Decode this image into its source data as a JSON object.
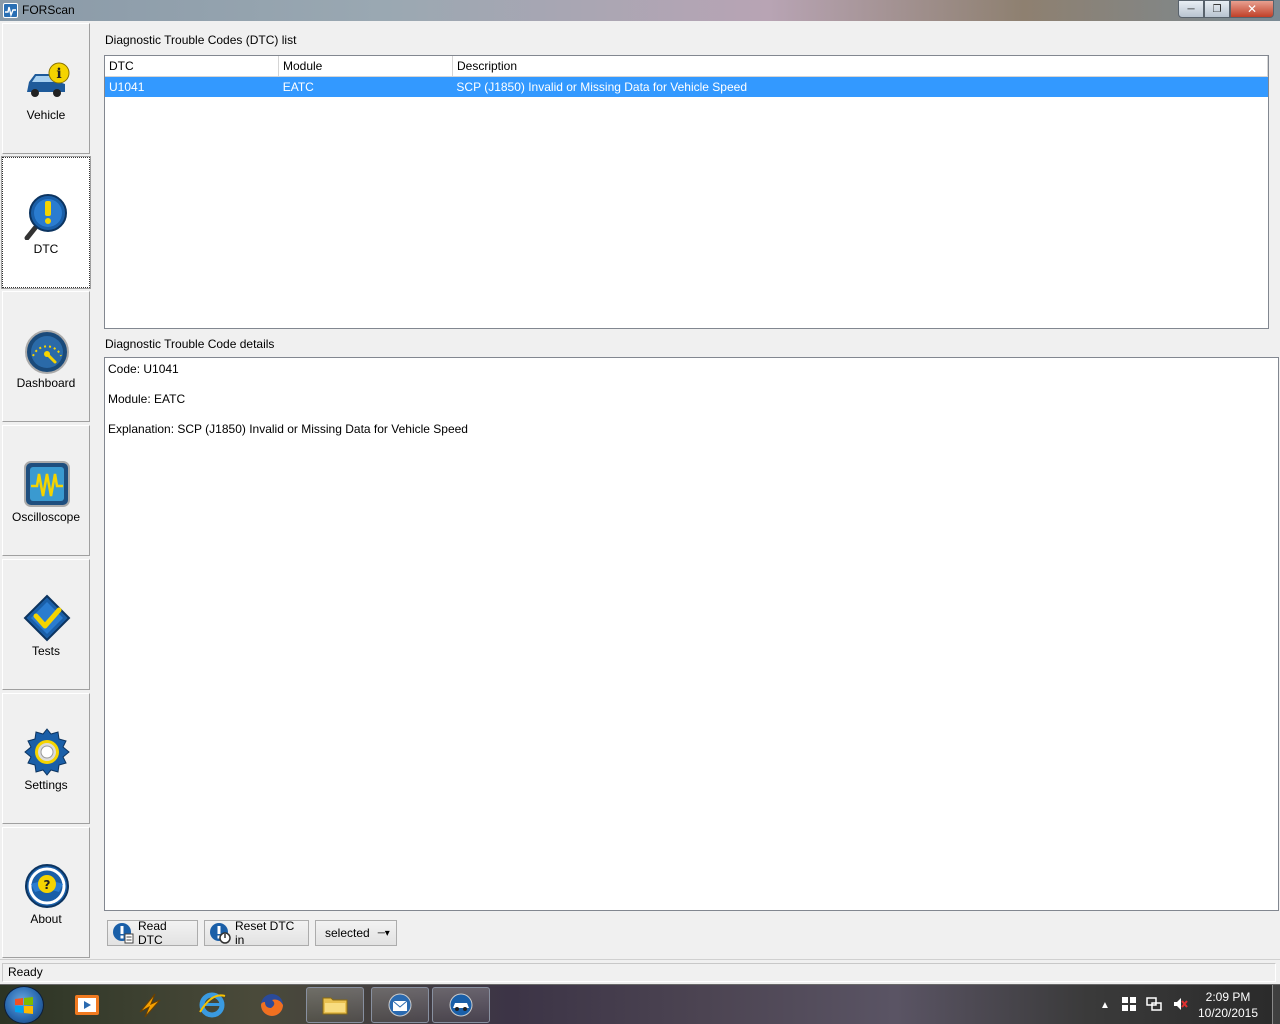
{
  "window": {
    "title": "FORScan"
  },
  "sidebar": {
    "items": [
      {
        "label": "Vehicle",
        "icon": "car-info-icon"
      },
      {
        "label": "DTC",
        "icon": "dtc-magnifier-icon",
        "active": true
      },
      {
        "label": "Dashboard",
        "icon": "gauge-icon"
      },
      {
        "label": "Oscilloscope",
        "icon": "oscilloscope-icon"
      },
      {
        "label": "Tests",
        "icon": "checkmark-diamond-icon"
      },
      {
        "label": "Settings",
        "icon": "gear-icon"
      },
      {
        "label": "About",
        "icon": "help-wheel-icon"
      }
    ]
  },
  "dtc_list": {
    "label": "Diagnostic Trouble Codes (DTC) list",
    "columns": [
      "DTC",
      "Module",
      "Description"
    ],
    "rows": [
      {
        "dtc": "U1041",
        "module": "EATC",
        "description": "SCP (J1850) Invalid or Missing Data for Vehicle Speed"
      }
    ]
  },
  "dtc_details": {
    "label": "Diagnostic Trouble Code details",
    "code": "Code: U1041",
    "module": "Module: EATC",
    "explanation": "Explanation: SCP (J1850) Invalid or Missing Data for Vehicle Speed"
  },
  "buttons": {
    "read": "Read DTC",
    "reset": "Reset DTC in",
    "selector": "selected"
  },
  "status": {
    "text": "Ready"
  },
  "taskbar": {
    "time": "2:09 PM",
    "date": "10/20/2015"
  }
}
